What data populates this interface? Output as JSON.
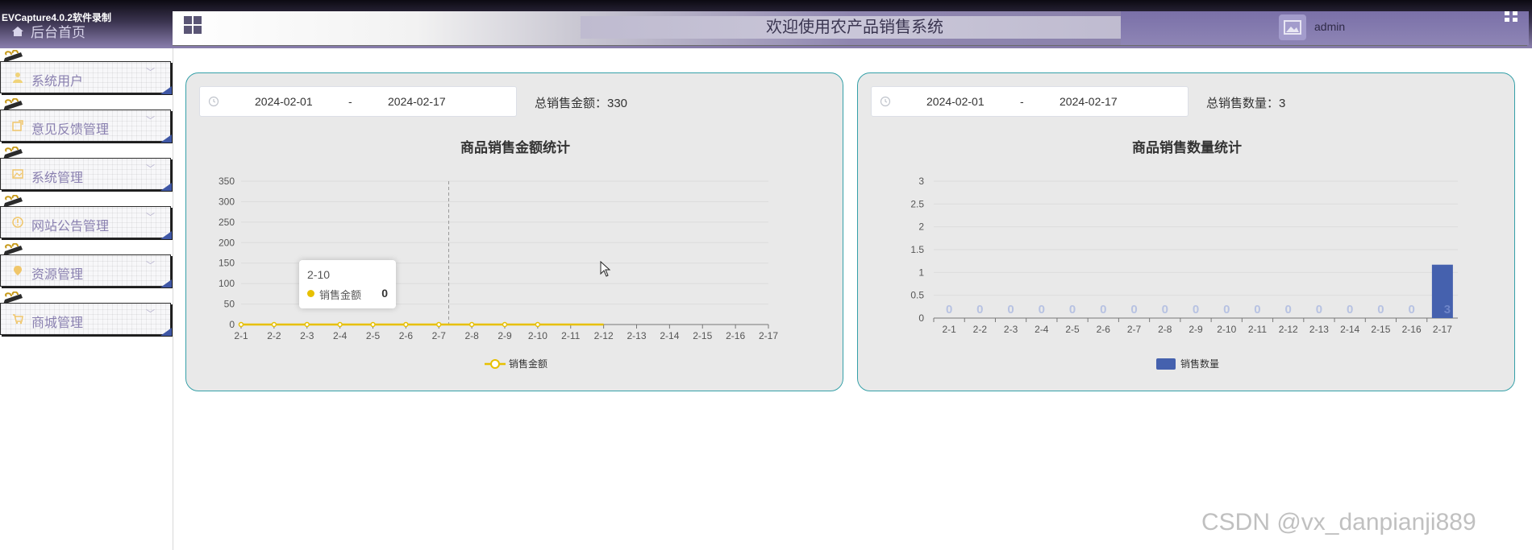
{
  "recorder_label": "EVCapture4.0.2软件录制",
  "header": {
    "home_label": "后台首页",
    "title": "欢迎使用农产品销售系统",
    "username": "admin"
  },
  "sidebar": {
    "items": [
      {
        "label": "系统用户",
        "icon": "user-icon"
      },
      {
        "label": "意见反馈管理",
        "icon": "feedback-icon"
      },
      {
        "label": "系统管理",
        "icon": "image-icon"
      },
      {
        "label": "网站公告管理",
        "icon": "info-icon"
      },
      {
        "label": "资源管理",
        "icon": "location-icon"
      },
      {
        "label": "商城管理",
        "icon": "cart-icon"
      }
    ]
  },
  "amount_panel": {
    "date_start": "2024-02-01",
    "date_sep": "-",
    "date_end": "2024-02-17",
    "total_label": "总销售金额：330",
    "tooltip": {
      "title": "2-10",
      "series": "销售金额",
      "value": "0"
    }
  },
  "quantity_panel": {
    "date_start": "2024-02-01",
    "date_sep": "-",
    "date_end": "2024-02-17",
    "total_label": "总销售数量：3"
  },
  "watermark": "CSDN @vx_danpianji889",
  "colors": {
    "accent": "#8a80b0",
    "line": "#e7c000",
    "bar": "#4561ae",
    "panel_border": "#35a0a8"
  },
  "chart_data": [
    {
      "type": "line",
      "title": "商品销售金额统计",
      "categories": [
        "2-1",
        "2-2",
        "2-3",
        "2-4",
        "2-5",
        "2-6",
        "2-7",
        "2-8",
        "2-9",
        "2-10",
        "2-11",
        "2-12",
        "2-13",
        "2-14",
        "2-15",
        "2-16",
        "2-17"
      ],
      "yticks": [
        0,
        50,
        100,
        150,
        200,
        250,
        300,
        350
      ],
      "ylim": [
        0,
        350
      ],
      "series": [
        {
          "name": "销售金额",
          "values": [
            0,
            0,
            0,
            0,
            0,
            0,
            0,
            0,
            0,
            0,
            0,
            0
          ]
        }
      ],
      "legend": "bottom",
      "grid": true
    },
    {
      "type": "bar",
      "title": "商品销售数量统计",
      "categories": [
        "2-1",
        "2-2",
        "2-3",
        "2-4",
        "2-5",
        "2-6",
        "2-7",
        "2-8",
        "2-9",
        "2-10",
        "2-11",
        "2-12",
        "2-13",
        "2-14",
        "2-15",
        "2-16",
        "2-17"
      ],
      "yticks": [
        "0",
        "0.5",
        "1",
        "1.5",
        "2",
        "2.5",
        "3"
      ],
      "ylim": [
        0,
        3
      ],
      "series": [
        {
          "name": "销售数量",
          "values": [
            0,
            0,
            0,
            0,
            0,
            0,
            0,
            0,
            0,
            0,
            0,
            0,
            0,
            0,
            0,
            0,
            3
          ],
          "bar_value_display": 1.17
        }
      ],
      "data_labels": [
        "0",
        "0",
        "0",
        "0",
        "0",
        "0",
        "0",
        "0",
        "0",
        "0",
        "0",
        "0",
        "0",
        "0",
        "0",
        "0",
        "3"
      ],
      "legend": "bottom",
      "grid": true
    }
  ]
}
